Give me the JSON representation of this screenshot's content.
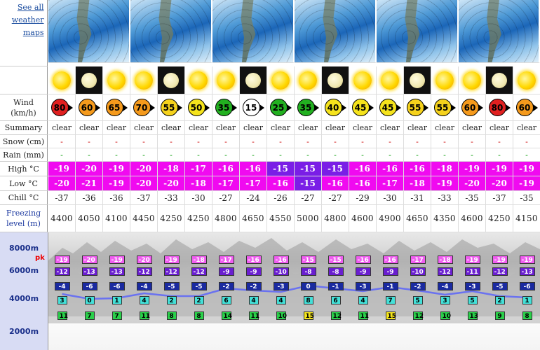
{
  "link": {
    "text": "See all weather maps"
  },
  "labels": {
    "wind": "Wind (km/h)",
    "summary": "Summary",
    "snow": "Snow (cm)",
    "rain": "Rain (mm)",
    "high": "High °C",
    "low": "Low °C",
    "chill": "Chill °C",
    "freezing": "Freezing level (m)"
  },
  "icons": [
    "sun",
    "moon",
    "sun",
    "sun",
    "moon",
    "sun",
    "sun",
    "moon",
    "sun",
    "sun",
    "moon",
    "sun",
    "sun",
    "moon",
    "sun",
    "sun",
    "moon",
    "sun"
  ],
  "wind": [
    {
      "v": "80",
      "c": "#e02020"
    },
    {
      "v": "60",
      "c": "#f59a1c"
    },
    {
      "v": "65",
      "c": "#f59a1c"
    },
    {
      "v": "70",
      "c": "#f59a1c"
    },
    {
      "v": "55",
      "c": "#f5d21c"
    },
    {
      "v": "50",
      "c": "#f5e31c"
    },
    {
      "v": "35",
      "c": "#22b020"
    },
    {
      "v": "15",
      "c": "#ffffff"
    },
    {
      "v": "25",
      "c": "#22b020"
    },
    {
      "v": "35",
      "c": "#22b020"
    },
    {
      "v": "40",
      "c": "#f5e31c"
    },
    {
      "v": "45",
      "c": "#f5e31c"
    },
    {
      "v": "45",
      "c": "#f5e31c"
    },
    {
      "v": "55",
      "c": "#f5d21c"
    },
    {
      "v": "55",
      "c": "#f5d21c"
    },
    {
      "v": "60",
      "c": "#f59a1c"
    },
    {
      "v": "80",
      "c": "#e02020"
    },
    {
      "v": "60",
      "c": "#f59a1c"
    }
  ],
  "summary": [
    "clear",
    "clear",
    "clear",
    "clear",
    "clear",
    "clear",
    "clear",
    "clear",
    "clear",
    "clear",
    "clear",
    "clear",
    "clear",
    "clear",
    "clear",
    "clear",
    "clear",
    "clear"
  ],
  "snow": [
    "-",
    "-",
    "-",
    "-",
    "-",
    "-",
    "-",
    "-",
    "-",
    "-",
    "-",
    "-",
    "-",
    "-",
    "-",
    "-",
    "-",
    "-"
  ],
  "rain": [
    "-",
    "-",
    "-",
    "-",
    "-",
    "-",
    "-",
    "-",
    "-",
    "-",
    "-",
    "-",
    "-",
    "-",
    "-",
    "-",
    "-",
    "-"
  ],
  "high": [
    {
      "v": "-19",
      "c": "#f00af0"
    },
    {
      "v": "-20",
      "c": "#f00af0"
    },
    {
      "v": "-19",
      "c": "#f00af0"
    },
    {
      "v": "-20",
      "c": "#f00af0"
    },
    {
      "v": "-18",
      "c": "#f00af0"
    },
    {
      "v": "-17",
      "c": "#f00af0"
    },
    {
      "v": "-16",
      "c": "#f00af0"
    },
    {
      "v": "-16",
      "c": "#f00af0"
    },
    {
      "v": "-15",
      "c": "#7a1ee6"
    },
    {
      "v": "-15",
      "c": "#7a1ee6"
    },
    {
      "v": "-15",
      "c": "#7a1ee6"
    },
    {
      "v": "-16",
      "c": "#f00af0"
    },
    {
      "v": "-16",
      "c": "#f00af0"
    },
    {
      "v": "-16",
      "c": "#f00af0"
    },
    {
      "v": "-18",
      "c": "#f00af0"
    },
    {
      "v": "-19",
      "c": "#f00af0"
    },
    {
      "v": "-19",
      "c": "#f00af0"
    },
    {
      "v": "-19",
      "c": "#f00af0"
    }
  ],
  "low": [
    {
      "v": "-20",
      "c": "#f00af0"
    },
    {
      "v": "-21",
      "c": "#f00af0"
    },
    {
      "v": "-19",
      "c": "#f00af0"
    },
    {
      "v": "-20",
      "c": "#f00af0"
    },
    {
      "v": "-20",
      "c": "#f00af0"
    },
    {
      "v": "-18",
      "c": "#f00af0"
    },
    {
      "v": "-17",
      "c": "#f00af0"
    },
    {
      "v": "-17",
      "c": "#f00af0"
    },
    {
      "v": "-16",
      "c": "#f00af0"
    },
    {
      "v": "-15",
      "c": "#7a1ee6"
    },
    {
      "v": "-16",
      "c": "#f00af0"
    },
    {
      "v": "-16",
      "c": "#f00af0"
    },
    {
      "v": "-17",
      "c": "#f00af0"
    },
    {
      "v": "-18",
      "c": "#f00af0"
    },
    {
      "v": "-19",
      "c": "#f00af0"
    },
    {
      "v": "-20",
      "c": "#f00af0"
    },
    {
      "v": "-20",
      "c": "#f00af0"
    },
    {
      "v": "-19",
      "c": "#f00af0"
    }
  ],
  "chill": [
    "-37",
    "-36",
    "-36",
    "-37",
    "-33",
    "-30",
    "-27",
    "-24",
    "-26",
    "-27",
    "-27",
    "-29",
    "-30",
    "-31",
    "-33",
    "-35",
    "-37",
    "-35"
  ],
  "freezing": [
    "4400",
    "4050",
    "4100",
    "4450",
    "4250",
    "4250",
    "4800",
    "4650",
    "4550",
    "5000",
    "4800",
    "4600",
    "4900",
    "4650",
    "4350",
    "4600",
    "4250",
    "4150"
  ],
  "chart": {
    "axis": [
      "8000m",
      "6000m",
      "4000m",
      "2000m"
    ],
    "pk": "pk",
    "row1": [
      "-19",
      "-20",
      "-19",
      "-20",
      "-19",
      "-18",
      "-17",
      "-16",
      "-16",
      "-15",
      "-15",
      "-16",
      "-16",
      "-17",
      "-18",
      "-19",
      "-19",
      "-19"
    ],
    "row2": [
      "-12",
      "-13",
      "-13",
      "-12",
      "-12",
      "-12",
      "-9",
      "-9",
      "-10",
      "-8",
      "-8",
      "-9",
      "-9",
      "-10",
      "-12",
      "-11",
      "-12",
      "-13"
    ],
    "row3": [
      "-4",
      "-6",
      "-6",
      "-4",
      "-5",
      "-5",
      "-2",
      "-2",
      "-3",
      "0",
      "-1",
      "-3",
      "-1",
      "-2",
      "-4",
      "-3",
      "-5",
      "-6"
    ],
    "row4": [
      "3",
      "0",
      "1",
      "4",
      "2",
      "2",
      "6",
      "4",
      "4",
      "8",
      "6",
      "4",
      "7",
      "5",
      "3",
      "5",
      "2",
      "1"
    ],
    "row5": [
      "11",
      "7",
      "7",
      "11",
      "8",
      "8",
      "14",
      "11",
      "10",
      "15",
      "12",
      "11",
      "15",
      "12",
      "10",
      "13",
      "9",
      "8"
    ],
    "colors": {
      "row1": "#f05cf0",
      "row2": "#6a1ed0",
      "row3": "#1a2aa0",
      "row4": "#44e0d8",
      "row5": "#2ad04a",
      "row5_alt": "#f5e61c",
      "freezing_line": "#6a72f0"
    }
  }
}
